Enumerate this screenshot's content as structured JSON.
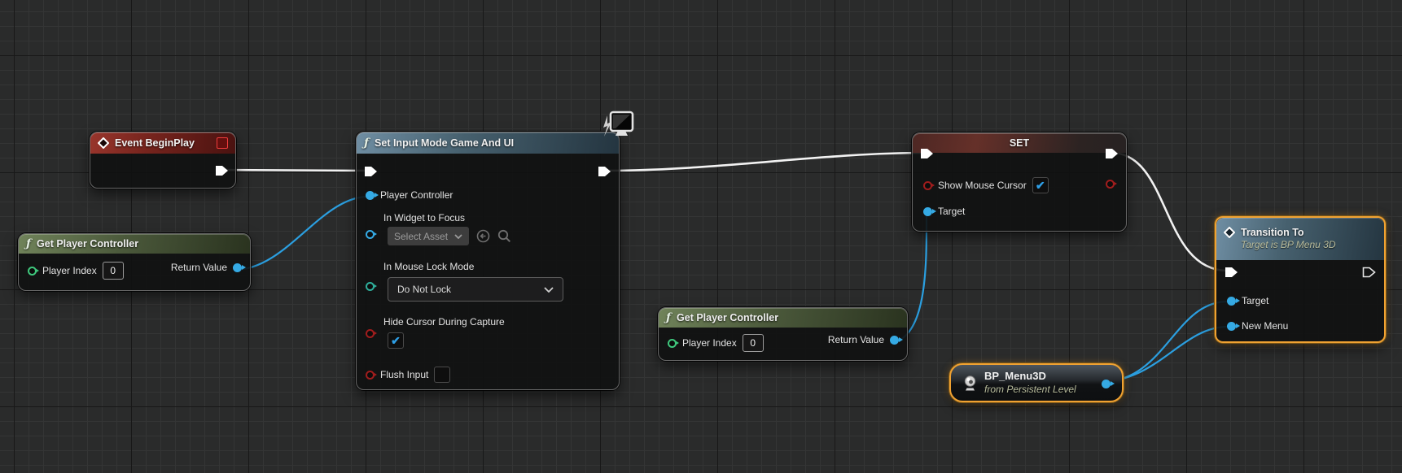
{
  "icons": {
    "function_glyph": "ƒ"
  },
  "colors": {
    "selection_orange": "#f0a232",
    "exec_wire": "#f2f2f2",
    "data_wire": "#2b9fe0",
    "pin_blue": "#35aae4",
    "pin_green": "#3fc87d",
    "pin_teal": "#2fae9b",
    "pin_red": "#a01d1d",
    "checkbox_check_blue": "#2e9fe6",
    "grid_background": "#2a2b2b"
  },
  "nodes": {
    "event_begin_play": {
      "title": "Event BeginPlay"
    },
    "get_player_controller_left": {
      "title": "Get Player Controller",
      "player_index_label": "Player Index",
      "player_index_value": "0",
      "return_value_label": "Return Value"
    },
    "set_input_mode_game_and_ui": {
      "title": "Set Input Mode Game And UI",
      "player_controller_label": "Player Controller",
      "in_widget_to_focus_label": "In Widget to Focus",
      "select_asset_label": "Select Asset",
      "in_mouse_lock_mode_label": "In Mouse Lock Mode",
      "in_mouse_lock_mode_value": "Do Not Lock",
      "hide_cursor_during_capture_label": "Hide Cursor During Capture",
      "hide_cursor_checked_glyph": "✔",
      "flush_input_label": "Flush Input",
      "flush_input_checked_glyph": ""
    },
    "set_show_mouse_cursor": {
      "title": "SET",
      "show_mouse_cursor_label": "Show Mouse Cursor",
      "show_mouse_cursor_checked_glyph": "✔",
      "target_label": "Target"
    },
    "get_player_controller_right": {
      "title": "Get Player Controller",
      "player_index_label": "Player Index",
      "player_index_value": "0",
      "return_value_label": "Return Value"
    },
    "bp_menu3d": {
      "title": "BP_Menu3D",
      "subtitle": "from Persistent Level"
    },
    "transition_to": {
      "title": "Transition To",
      "subtitle": "Target is BP Menu 3D",
      "target_label": "Target",
      "new_menu_label": "New Menu"
    }
  }
}
